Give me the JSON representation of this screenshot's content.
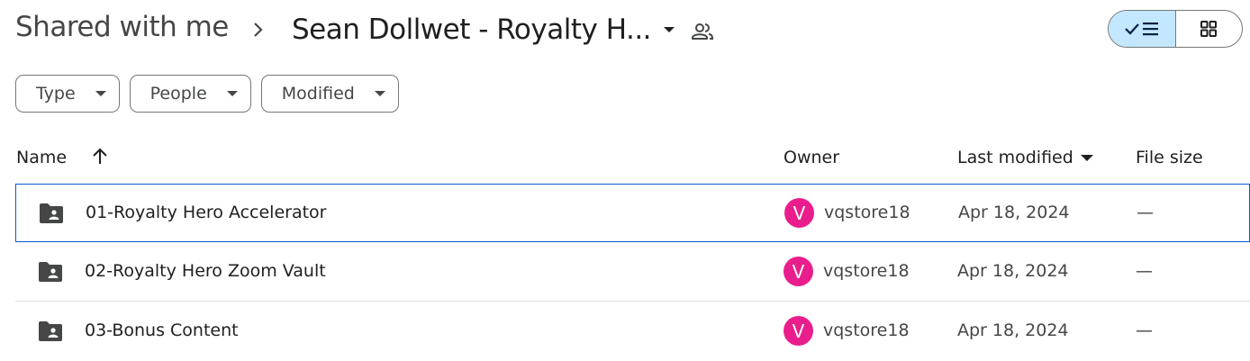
{
  "breadcrumb": {
    "root": "Shared with me",
    "separator_icon": "chevron-right-icon",
    "current": "Sean Dollwet - Royalty H...",
    "dropdown_icon": "arrow-drop-down-icon",
    "shared_icon": "people-icon"
  },
  "view_toggle": {
    "list_icon": "check-list-icon",
    "grid_icon": "grid-icon",
    "active": "list"
  },
  "filters": [
    {
      "label": "Type"
    },
    {
      "label": "People"
    },
    {
      "label": "Modified"
    }
  ],
  "columns": {
    "name": "Name",
    "owner": "Owner",
    "last_modified": "Last modified",
    "file_size": "File size",
    "sort_icon": "arrow-up-icon"
  },
  "rows": [
    {
      "name": "01-Royalty Hero Accelerator",
      "owner_initial": "V",
      "owner": "vqstore18",
      "modified": "Apr 18, 2024",
      "size": "—",
      "selected": true
    },
    {
      "name": "02-Royalty Hero Zoom Vault",
      "owner_initial": "V",
      "owner": "vqstore18",
      "modified": "Apr 18, 2024",
      "size": "—",
      "selected": false
    },
    {
      "name": "03-Bonus Content",
      "owner_initial": "V",
      "owner": "vqstore18",
      "modified": "Apr 18, 2024",
      "size": "—",
      "selected": false
    }
  ],
  "colors": {
    "accent": "#0b57d0",
    "toggle_active": "#c2e7ff",
    "avatar": "#e91e8c"
  }
}
